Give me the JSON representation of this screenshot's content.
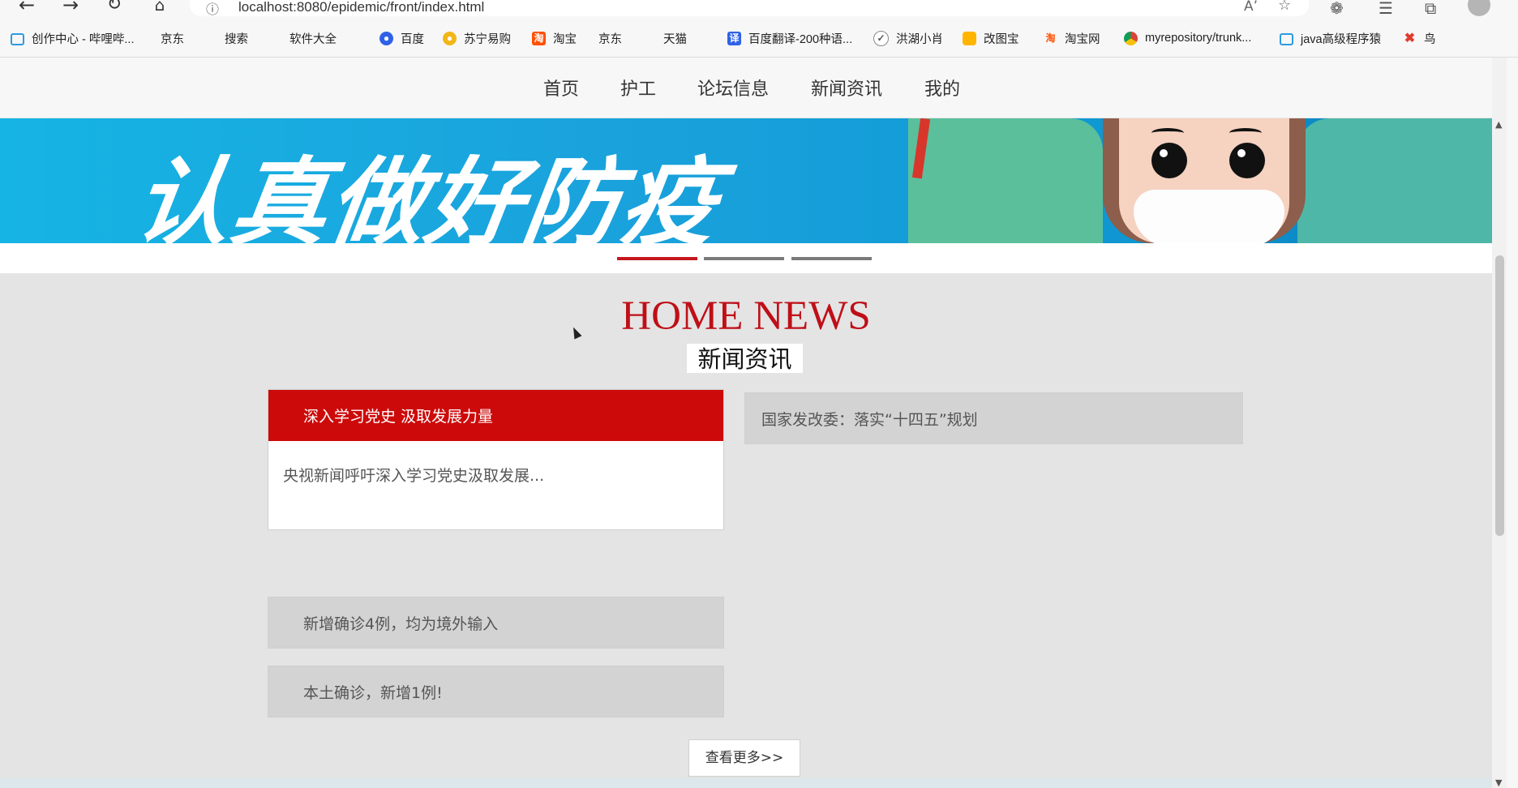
{
  "browser": {
    "url": "localhost:8080/epidemic/front/index.html",
    "info_icon": "info-icon",
    "bookmarks": [
      {
        "label": "创作中心 - 哔哩哔...",
        "icon": "bilibili-icon"
      },
      {
        "label": "京东",
        "icon": "page-icon"
      },
      {
        "label": "搜索",
        "icon": "page-icon"
      },
      {
        "label": "软件大全",
        "icon": "page-icon"
      },
      {
        "label": "百度",
        "icon": "baidu-paw-icon"
      },
      {
        "label": "苏宁易购",
        "icon": "suning-icon"
      },
      {
        "label": "淘宝",
        "icon": "taobao-icon"
      },
      {
        "label": "京东",
        "icon": "page-icon"
      },
      {
        "label": "天猫",
        "icon": "page-icon"
      },
      {
        "label": "百度翻译-200种语...",
        "icon": "baidu-translate-icon"
      },
      {
        "label": "洪湖小肖",
        "icon": "honghu-icon"
      },
      {
        "label": "改图宝",
        "icon": "gaitubao-icon"
      },
      {
        "label": "淘宝网",
        "icon": "taobao-icon"
      },
      {
        "label": "myrepository/trunk...",
        "icon": "chrome-icon"
      },
      {
        "label": "java高级程序猿",
        "icon": "bilibili-icon"
      },
      {
        "label": "鸟",
        "icon": "bird-icon"
      }
    ]
  },
  "site": {
    "nav": [
      "首页",
      "护工",
      "论坛信息",
      "新闻资讯",
      "我的"
    ],
    "banner_text": "认真做好防疫",
    "carousel_active": 0,
    "section": {
      "title_en": "HOME NEWS",
      "title_cn": "新闻资讯"
    },
    "news": {
      "featured": {
        "title": "深入学习党史 汲取发展力量",
        "summary": "央视新闻呼吁深入学习党史汲取发展..."
      },
      "items": [
        "国家发改委：落实“十四五”规划",
        "新增确诊4例，均为境外输入",
        "本土确诊，新增1例!"
      ]
    },
    "more_button": "查看更多>>"
  },
  "colors": {
    "brand_red": "#cd0a0a",
    "title_red": "#bf0f17",
    "banner_blue": "#16b4e4"
  }
}
